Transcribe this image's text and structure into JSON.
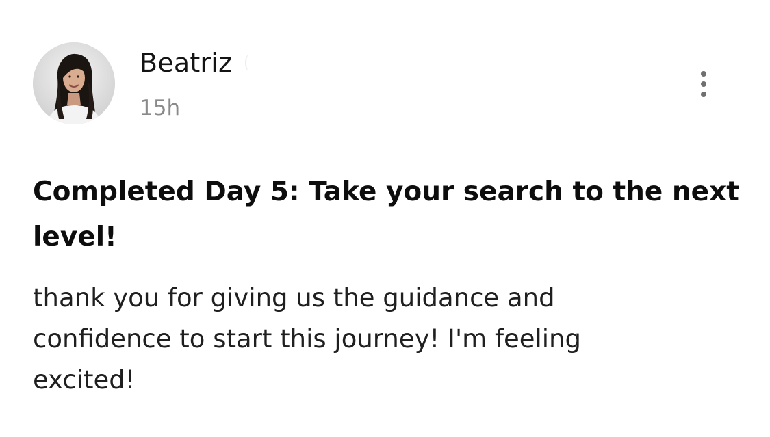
{
  "post": {
    "author": {
      "name": "Beatriz",
      "avatar_icon": "profile-photo"
    },
    "time_ago": "15h",
    "more_icon": "vertical-ellipsis-icon",
    "title": "Completed Day 5: Take your search to the next level!",
    "body": "thank you for giving us the guidance and confidence to start this journey! I'm feeling excited!"
  },
  "colors": {
    "background": "#ffffff",
    "title_text": "#0d0d0d",
    "body_text": "#1f1f1f",
    "meta_text": "#8a8a8a",
    "icon": "#6f6f6f"
  }
}
